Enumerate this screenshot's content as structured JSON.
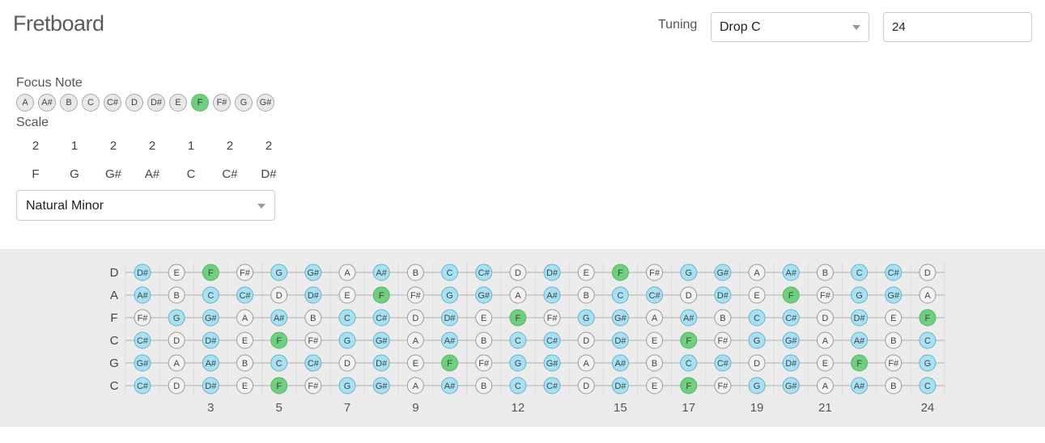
{
  "app": {
    "title": "Fretboard"
  },
  "tuning": {
    "label": "Tuning",
    "selected": "Drop C",
    "fret_count": "24"
  },
  "focus": {
    "label": "Focus Note",
    "notes": [
      "A",
      "A#",
      "B",
      "C",
      "C#",
      "D",
      "D#",
      "E",
      "F",
      "F#",
      "G",
      "G#"
    ],
    "selected": "F"
  },
  "scale": {
    "label": "Scale",
    "intervals": [
      "2",
      "1",
      "2",
      "2",
      "1",
      "2",
      "2"
    ],
    "notes": [
      "F",
      "G",
      "G#",
      "A#",
      "C",
      "C#",
      "D#"
    ],
    "selected": "Natural Minor"
  },
  "fretboard": {
    "strings": [
      {
        "label": "D",
        "notes": [
          "D#",
          "E",
          "F",
          "F#",
          "G",
          "G#",
          "A",
          "A#",
          "B",
          "C",
          "C#",
          "D",
          "D#",
          "E",
          "F",
          "F#",
          "G",
          "G#",
          "A",
          "A#",
          "B",
          "C",
          "C#",
          "D"
        ]
      },
      {
        "label": "A",
        "notes": [
          "A#",
          "B",
          "C",
          "C#",
          "D",
          "D#",
          "E",
          "F",
          "F#",
          "G",
          "G#",
          "A",
          "A#",
          "B",
          "C",
          "C#",
          "D",
          "D#",
          "E",
          "F",
          "F#",
          "G",
          "G#",
          "A"
        ]
      },
      {
        "label": "F",
        "notes": [
          "F#",
          "G",
          "G#",
          "A",
          "A#",
          "B",
          "C",
          "C#",
          "D",
          "D#",
          "E",
          "F",
          "F#",
          "G",
          "G#",
          "A",
          "A#",
          "B",
          "C",
          "C#",
          "D",
          "D#",
          "E",
          "F"
        ]
      },
      {
        "label": "C",
        "notes": [
          "C#",
          "D",
          "D#",
          "E",
          "F",
          "F#",
          "G",
          "G#",
          "A",
          "A#",
          "B",
          "C",
          "C#",
          "D",
          "D#",
          "E",
          "F",
          "F#",
          "G",
          "G#",
          "A",
          "A#",
          "B",
          "C"
        ]
      },
      {
        "label": "G",
        "notes": [
          "G#",
          "A",
          "A#",
          "B",
          "C",
          "C#",
          "D",
          "D#",
          "E",
          "F",
          "F#",
          "G",
          "G#",
          "A",
          "A#",
          "B",
          "C",
          "C#",
          "D",
          "D#",
          "E",
          "F",
          "F#",
          "G"
        ]
      },
      {
        "label": "C",
        "notes": [
          "C#",
          "D",
          "D#",
          "E",
          "F",
          "F#",
          "G",
          "G#",
          "A",
          "A#",
          "B",
          "C",
          "C#",
          "D",
          "D#",
          "E",
          "F",
          "F#",
          "G",
          "G#",
          "A",
          "A#",
          "B",
          "C"
        ]
      }
    ],
    "fret_markers": [
      "3",
      "5",
      "7",
      "9",
      "12",
      "15",
      "17",
      "19",
      "21",
      "24"
    ],
    "colors": {
      "focus": "#6ed07f",
      "in_scale": "#a7e1f4",
      "other": "#f2f2f2"
    }
  }
}
